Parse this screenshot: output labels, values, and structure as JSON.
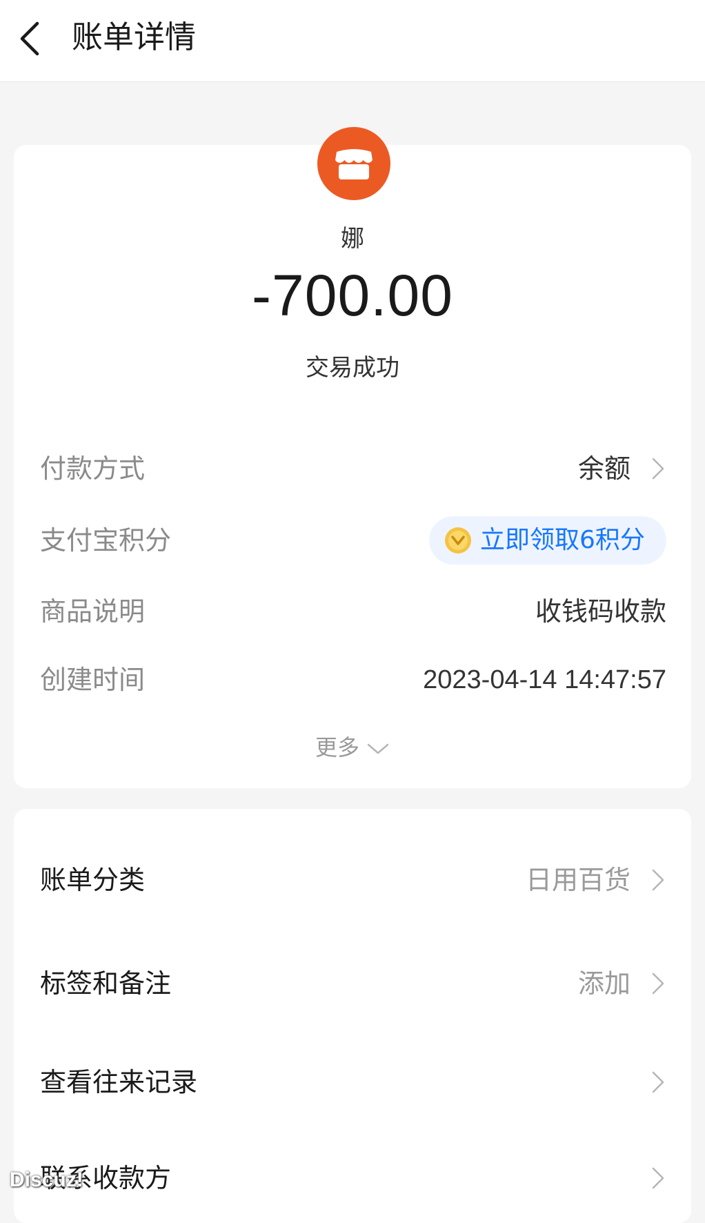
{
  "header": {
    "title": "账单详情"
  },
  "merchant": {
    "name": "娜",
    "amount": "-700.00",
    "status": "交易成功"
  },
  "details": [
    {
      "label": "付款方式",
      "value": "余额"
    },
    {
      "label": "支付宝积分",
      "value": "立即领取6积分"
    },
    {
      "label": "商品说明",
      "value": "收钱码收款"
    },
    {
      "label": "创建时间",
      "value": "2023-04-14 14:47:57"
    }
  ],
  "more_label": "更多",
  "actions": [
    {
      "label": "账单分类",
      "value": "日用百货"
    },
    {
      "label": "标签和备注",
      "value": "添加"
    },
    {
      "label": "查看往来记录",
      "value": ""
    },
    {
      "label": "联系收款方",
      "value": ""
    }
  ],
  "colors": {
    "accent_orange": "#ec5a24",
    "link_blue": "#1677ff",
    "coin_gold": "#f5c342"
  },
  "watermark": "Discuz!"
}
